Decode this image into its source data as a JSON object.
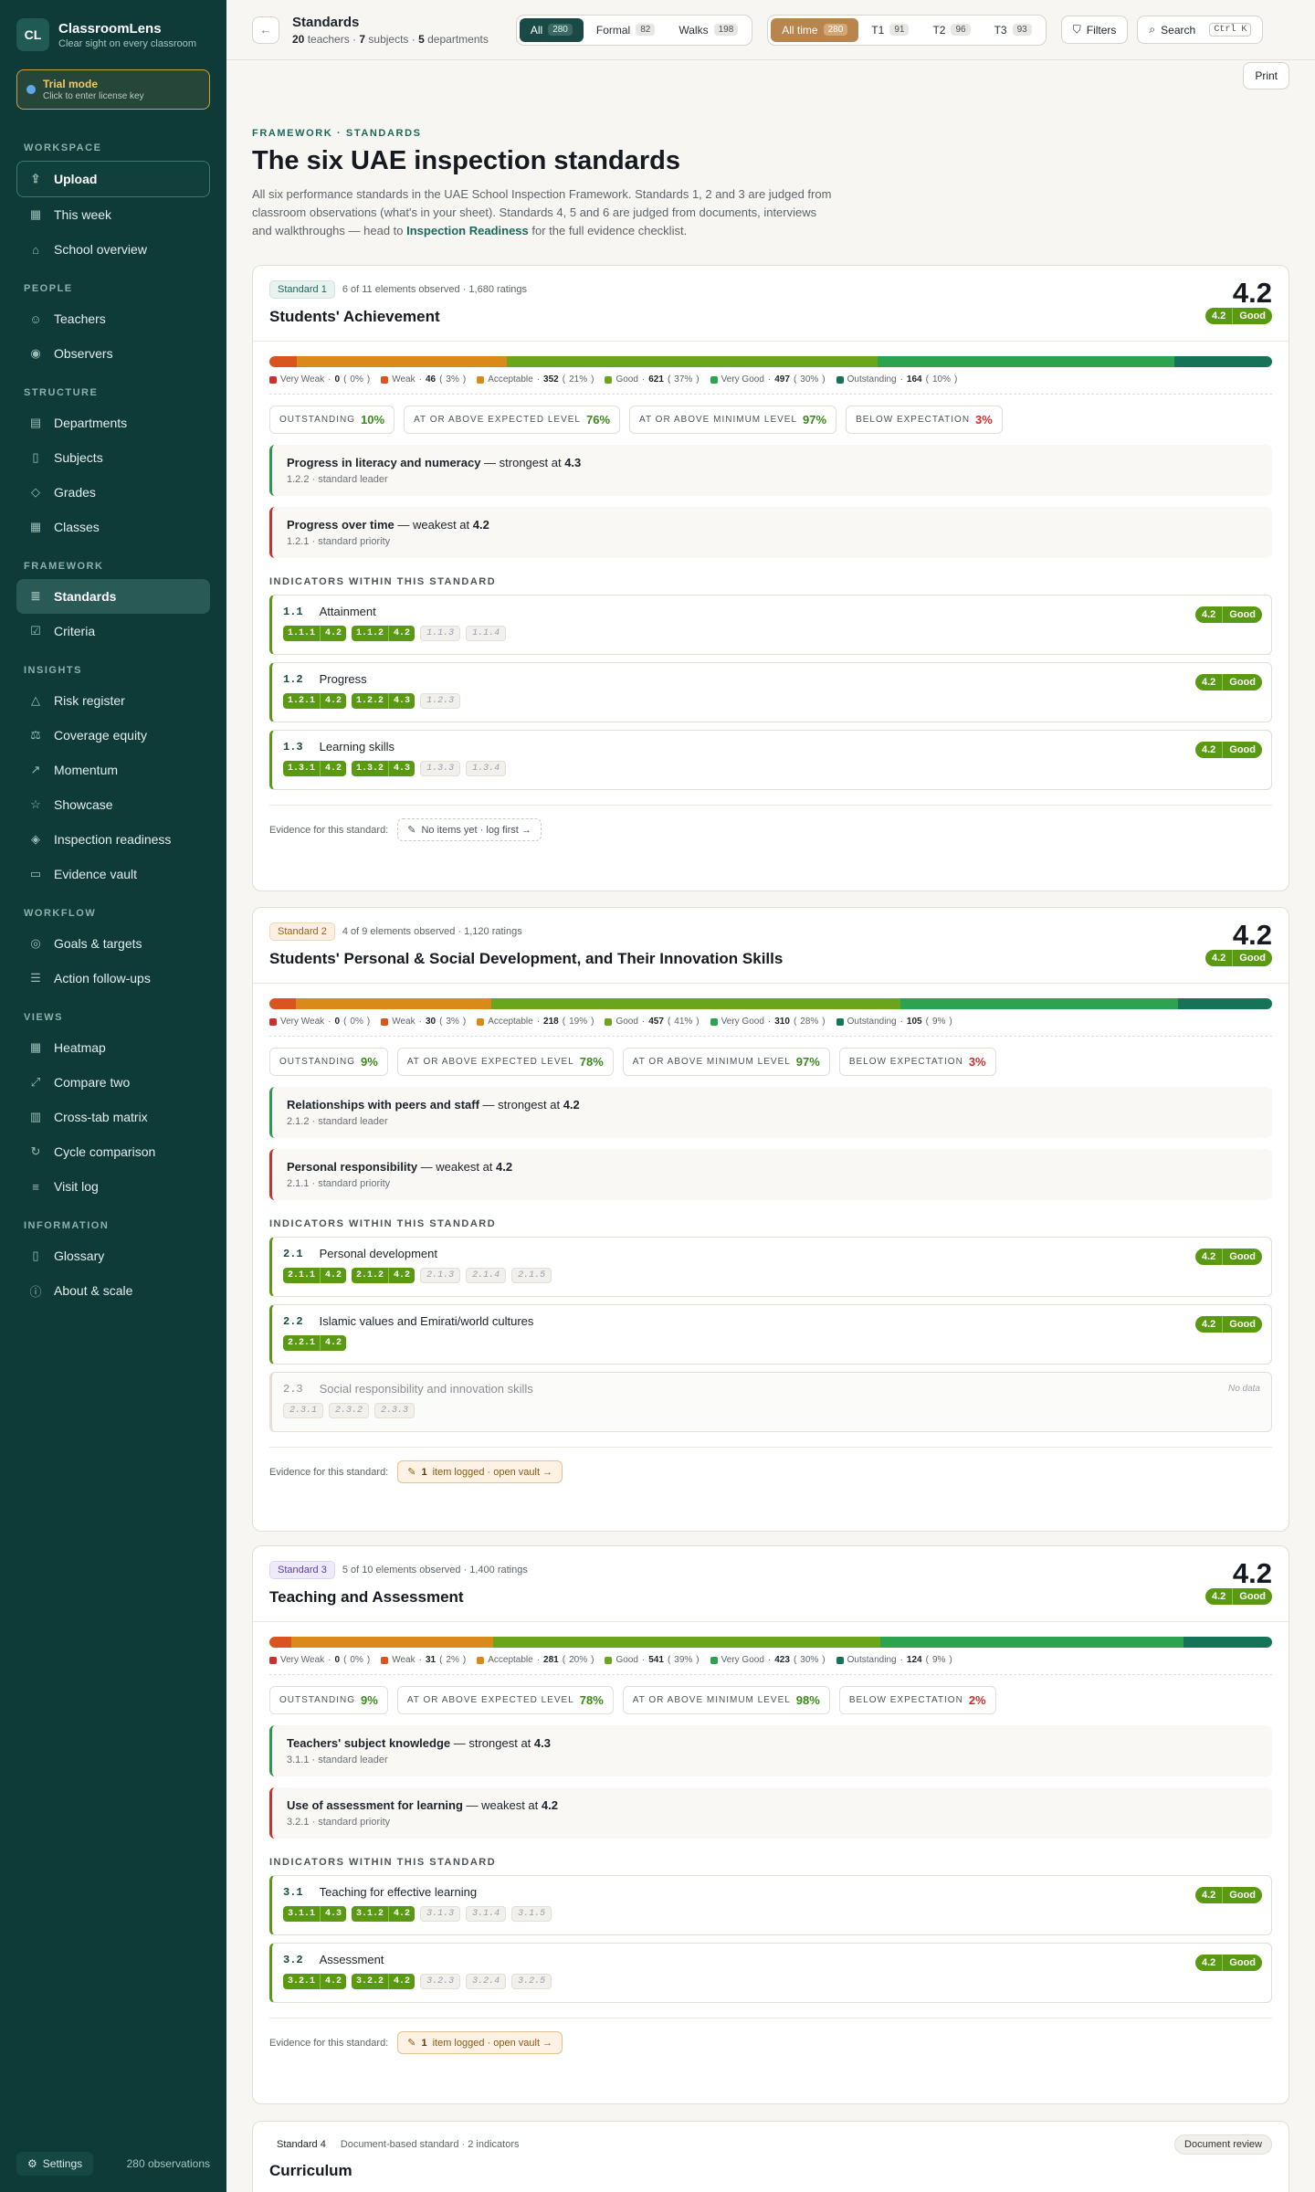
{
  "app": {
    "name": "ClassroomLens",
    "tagline": "Clear sight on every classroom",
    "logo": "CL"
  },
  "trial": {
    "title": "Trial mode",
    "sub": "Click to enter license key"
  },
  "sidebar": {
    "sections": {
      "workspace": "WORKSPACE",
      "people": "PEOPLE",
      "structure": "STRUCTURE",
      "framework": "FRAMEWORK",
      "insights": "INSIGHTS",
      "workflow": "WORKFLOW",
      "views": "VIEWS",
      "information": "INFORMATION"
    },
    "items": {
      "upload": "Upload",
      "this_week": "This week",
      "school_overview": "School overview",
      "teachers": "Teachers",
      "observers": "Observers",
      "departments": "Departments",
      "subjects": "Subjects",
      "grades": "Grades",
      "classes": "Classes",
      "standards": "Standards",
      "criteria": "Criteria",
      "risk_register": "Risk register",
      "coverage_equity": "Coverage equity",
      "momentum": "Momentum",
      "showcase": "Showcase",
      "inspection_readiness": "Inspection readiness",
      "evidence_vault": "Evidence vault",
      "goals_targets": "Goals & targets",
      "action_followups": "Action follow-ups",
      "heatmap": "Heatmap",
      "compare_two": "Compare two",
      "crosstab": "Cross-tab matrix",
      "cycle_comparison": "Cycle comparison",
      "visit_log": "Visit log",
      "glossary": "Glossary",
      "about_scale": "About & scale"
    },
    "footer": {
      "settings": "Settings",
      "observations": "280 observations"
    }
  },
  "header": {
    "title": "Standards",
    "sub": {
      "teachers_n": "20",
      "teachers_l": " teachers · ",
      "subjects_n": "7",
      "subjects_l": " subjects · ",
      "departments_n": "5",
      "departments_l": " departments"
    },
    "type_filter": [
      {
        "label": "All",
        "count": "280"
      },
      {
        "label": "Formal",
        "count": "82"
      },
      {
        "label": "Walks",
        "count": "198"
      }
    ],
    "time_filter": [
      {
        "label": "All time",
        "count": "280"
      },
      {
        "label": "T1",
        "count": "91"
      },
      {
        "label": "T2",
        "count": "96"
      },
      {
        "label": "T3",
        "count": "93"
      }
    ],
    "filters": "Filters",
    "search": "Search",
    "search_kbd": "Ctrl K",
    "print": "Print"
  },
  "page": {
    "eyebrow": "FRAMEWORK · STANDARDS",
    "title": "The six UAE inspection standards",
    "intro_a": "All six performance standards in the UAE School Inspection Framework. Standards 1, 2 and 3 are judged from classroom observations (what's in your sheet). Standards 4, 5 and 6 are judged from documents, interviews and walkthroughs — head to ",
    "intro_link": "Inspection Readiness",
    "intro_b": " for the full evidence checklist."
  },
  "labels": {
    "stats": {
      "outstanding": "OUTSTANDING",
      "expected": "AT OR ABOVE EXPECTED LEVEL",
      "minimum": "AT OR ABOVE MINIMUM LEVEL",
      "below": "BELOW EXPECTATION"
    },
    "indicators_heading": "INDICATORS WITHIN THIS STANDARD",
    "evidence": "Evidence for this standard:",
    "standard_leader": "standard leader",
    "standard_priority": "standard priority",
    "strongest": " — strongest at ",
    "weakest": " — weakest at ",
    "no_data": "No data"
  },
  "colors": {
    "very_weak": "#cf2f2f",
    "weak": "#d9541f",
    "acceptable": "#d98a1a",
    "good": "#6aa51b",
    "very_good": "#2ea34f",
    "outstanding": "#16735a"
  },
  "standards": [
    {
      "tag": "Standard 1",
      "meta": "6 of 11 elements observed · 1,680 ratings",
      "title": "Students' Achievement",
      "score": "4.2",
      "pill_score": "4.2",
      "pill_label": "Good",
      "dist": [
        {
          "label": "Very Weak",
          "count": "0",
          "pct": "0%",
          "value": 0
        },
        {
          "label": "Weak",
          "count": "46",
          "pct": "3%",
          "value": 46
        },
        {
          "label": "Acceptable",
          "count": "352",
          "pct": "21%",
          "value": 352
        },
        {
          "label": "Good",
          "count": "621",
          "pct": "37%",
          "value": 621
        },
        {
          "label": "Very Good",
          "count": "497",
          "pct": "30%",
          "value": 497
        },
        {
          "label": "Outstanding",
          "count": "164",
          "pct": "10%",
          "value": 164
        }
      ],
      "stats": {
        "outstanding": "10%",
        "expected": "76%",
        "minimum": "97%",
        "below": "3%"
      },
      "strong": {
        "name": "Progress in literacy and numeracy",
        "score": "4.3",
        "code": "1.2.2"
      },
      "weak": {
        "name": "Progress over time",
        "score": "4.2",
        "code": "1.2.1"
      },
      "indicators": [
        {
          "code": "1.1",
          "name": "Attainment",
          "score": "4.2",
          "label": "Good",
          "chips": [
            {
              "c": "1.1.1",
              "v": "4.2"
            },
            {
              "c": "1.1.2",
              "v": "4.2"
            },
            {
              "c": "1.1.3"
            },
            {
              "c": "1.1.4"
            }
          ]
        },
        {
          "code": "1.2",
          "name": "Progress",
          "score": "4.2",
          "label": "Good",
          "chips": [
            {
              "c": "1.2.1",
              "v": "4.2"
            },
            {
              "c": "1.2.2",
              "v": "4.3"
            },
            {
              "c": "1.2.3"
            }
          ]
        },
        {
          "code": "1.3",
          "name": "Learning skills",
          "score": "4.2",
          "label": "Good",
          "chips": [
            {
              "c": "1.3.1",
              "v": "4.2"
            },
            {
              "c": "1.3.2",
              "v": "4.3"
            },
            {
              "c": "1.3.3"
            },
            {
              "c": "1.3.4"
            }
          ]
        }
      ],
      "evidence": {
        "type": "empty",
        "text": "No items yet · log first →"
      }
    },
    {
      "tag": "Standard 2",
      "meta": "4 of 9 elements observed · 1,120 ratings",
      "title": "Students' Personal & Social Development, and Their Innovation Skills",
      "score": "4.2",
      "pill_score": "4.2",
      "pill_label": "Good",
      "dist": [
        {
          "label": "Very Weak",
          "count": "0",
          "pct": "0%",
          "value": 0
        },
        {
          "label": "Weak",
          "count": "30",
          "pct": "3%",
          "value": 30
        },
        {
          "label": "Acceptable",
          "count": "218",
          "pct": "19%",
          "value": 218
        },
        {
          "label": "Good",
          "count": "457",
          "pct": "41%",
          "value": 457
        },
        {
          "label": "Very Good",
          "count": "310",
          "pct": "28%",
          "value": 310
        },
        {
          "label": "Outstanding",
          "count": "105",
          "pct": "9%",
          "value": 105
        }
      ],
      "stats": {
        "outstanding": "9%",
        "expected": "78%",
        "minimum": "97%",
        "below": "3%"
      },
      "strong": {
        "name": "Relationships with peers and staff",
        "score": "4.2",
        "code": "2.1.2"
      },
      "weak": {
        "name": "Personal responsibility",
        "score": "4.2",
        "code": "2.1.1"
      },
      "indicators": [
        {
          "code": "2.1",
          "name": "Personal development",
          "score": "4.2",
          "label": "Good",
          "chips": [
            {
              "c": "2.1.1",
              "v": "4.2"
            },
            {
              "c": "2.1.2",
              "v": "4.2"
            },
            {
              "c": "2.1.3"
            },
            {
              "c": "2.1.4"
            },
            {
              "c": "2.1.5"
            }
          ]
        },
        {
          "code": "2.2",
          "name": "Islamic values and Emirati/world cultures",
          "score": "4.2",
          "label": "Good",
          "chips": [
            {
              "c": "2.2.1",
              "v": "4.2"
            }
          ]
        },
        {
          "code": "2.3",
          "name": "Social responsibility and innovation skills",
          "nodata": true,
          "chips": [
            {
              "c": "2.3.1"
            },
            {
              "c": "2.3.2"
            },
            {
              "c": "2.3.3"
            }
          ]
        }
      ],
      "evidence": {
        "type": "logged",
        "count": "1",
        "text": "item logged · open vault →"
      }
    },
    {
      "tag": "Standard 3",
      "meta": "5 of 10 elements observed · 1,400 ratings",
      "title": "Teaching and Assessment",
      "score": "4.2",
      "pill_score": "4.2",
      "pill_label": "Good",
      "dist": [
        {
          "label": "Very Weak",
          "count": "0",
          "pct": "0%",
          "value": 0
        },
        {
          "label": "Weak",
          "count": "31",
          "pct": "2%",
          "value": 31
        },
        {
          "label": "Acceptable",
          "count": "281",
          "pct": "20%",
          "value": 281
        },
        {
          "label": "Good",
          "count": "541",
          "pct": "39%",
          "value": 541
        },
        {
          "label": "Very Good",
          "count": "423",
          "pct": "30%",
          "value": 423
        },
        {
          "label": "Outstanding",
          "count": "124",
          "pct": "9%",
          "value": 124
        }
      ],
      "stats": {
        "outstanding": "9%",
        "expected": "78%",
        "minimum": "98%",
        "below": "2%"
      },
      "strong": {
        "name": "Teachers' subject knowledge",
        "score": "4.3",
        "code": "3.1.1"
      },
      "weak": {
        "name": "Use of assessment for learning",
        "score": "4.2",
        "code": "3.2.1"
      },
      "indicators": [
        {
          "code": "3.1",
          "name": "Teaching for effective learning",
          "score": "4.2",
          "label": "Good",
          "chips": [
            {
              "c": "3.1.1",
              "v": "4.3"
            },
            {
              "c": "3.1.2",
              "v": "4.2"
            },
            {
              "c": "3.1.3"
            },
            {
              "c": "3.1.4"
            },
            {
              "c": "3.1.5"
            }
          ]
        },
        {
          "code": "3.2",
          "name": "Assessment",
          "score": "4.2",
          "label": "Good",
          "chips": [
            {
              "c": "3.2.1",
              "v": "4.2"
            },
            {
              "c": "3.2.2",
              "v": "4.2"
            },
            {
              "c": "3.2.3"
            },
            {
              "c": "3.2.4"
            },
            {
              "c": "3.2.5"
            }
          ]
        }
      ],
      "evidence": {
        "type": "logged",
        "count": "1",
        "text": "item logged · open vault →"
      }
    }
  ],
  "standard4": {
    "tag": "Standard 4",
    "meta": "Document-based standard · 2 indicators",
    "title": "Curriculum",
    "badge": "Document review"
  }
}
